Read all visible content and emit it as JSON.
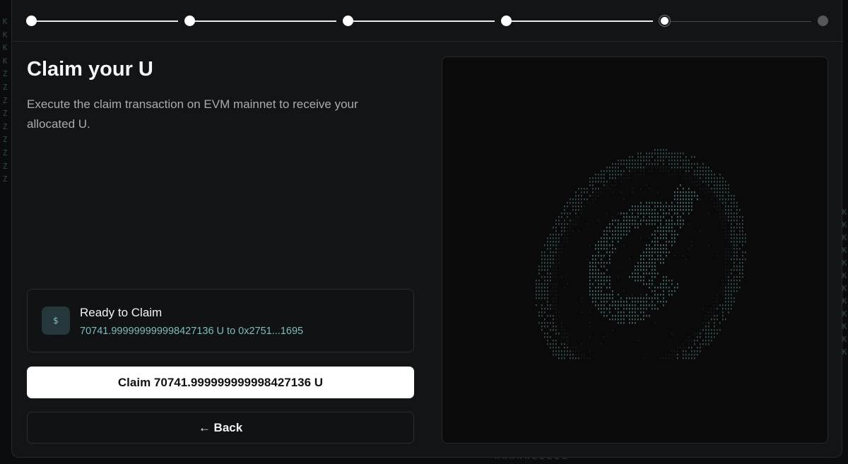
{
  "background": {
    "left_glyphs": [
      "K",
      "K",
      "K",
      "K",
      "Z",
      "Z",
      "Z",
      "Z",
      "Z",
      "Z",
      "Z",
      "Z",
      "Z"
    ],
    "right_glyphs": [
      "K",
      "K",
      "K",
      "K",
      "K",
      "K",
      "K",
      "K",
      "K",
      "K",
      "K",
      "K"
    ],
    "bottom_glyphs": "KKKKKZZZZZ"
  },
  "stepper": {
    "total_steps": 6,
    "current_step": 5,
    "completed_color": "#ffffff",
    "pending_color": "#55575c"
  },
  "header": {
    "title": "Claim your U",
    "description": "Execute the claim transaction on EVM mainnet to receive your allocated U."
  },
  "status": {
    "icon": "dollar-icon",
    "icon_glyph": "$",
    "title": "Ready to Claim",
    "detail": "70741.999999999998427136 U to 0x2751...1695",
    "accent_color": "#7fbcc0"
  },
  "actions": {
    "claim_label": "Claim 70741.999999999998427136 U",
    "back_label": "← Back"
  },
  "art": {
    "icon": "coin-ascii-art",
    "glyph_color": "#5f8f94"
  }
}
